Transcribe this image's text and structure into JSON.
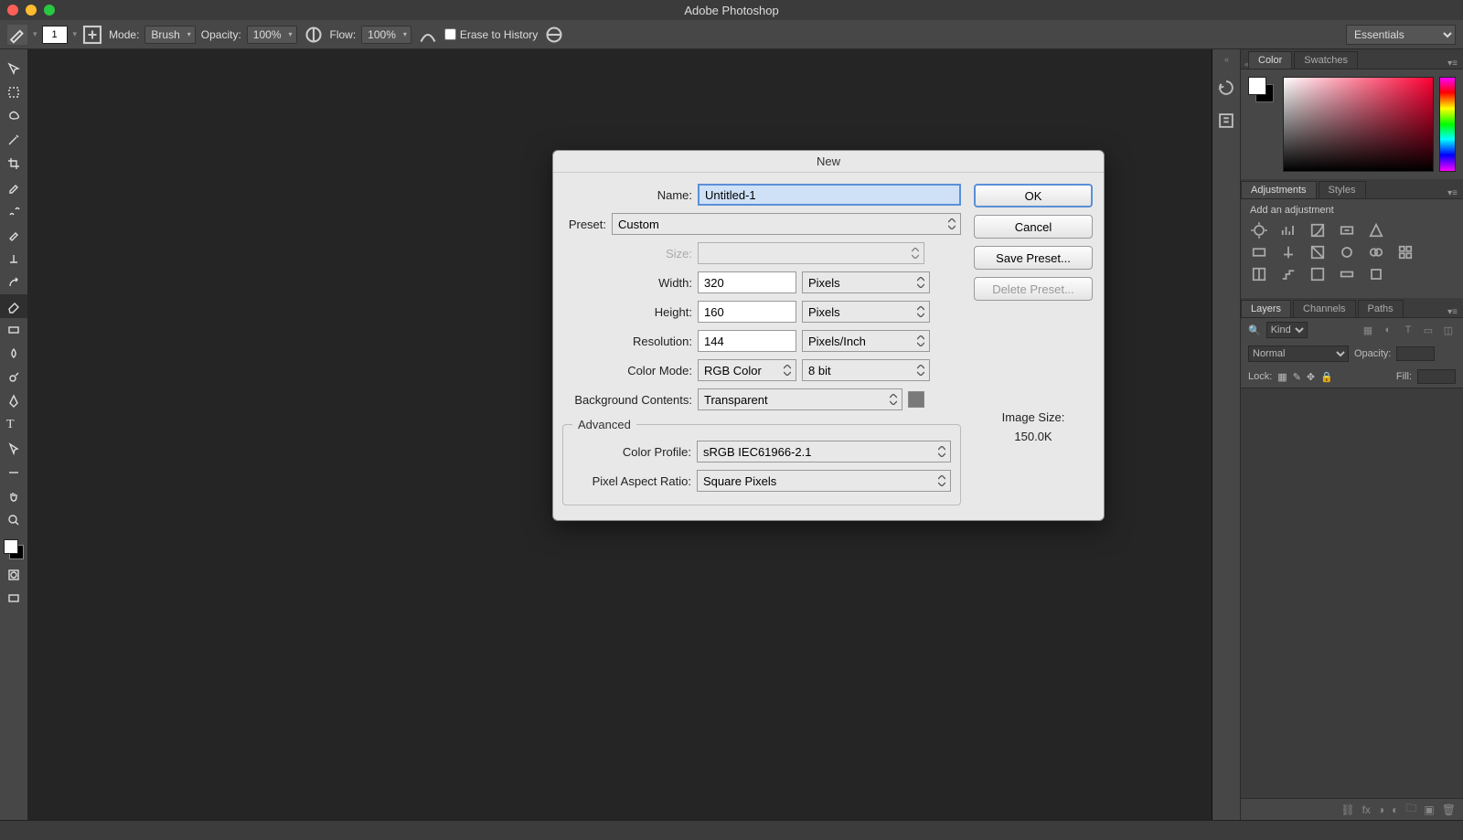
{
  "app_title": "Adobe Photoshop",
  "options_bar": {
    "brush_size": "1",
    "mode_label": "Mode:",
    "mode_value": "Brush",
    "opacity_label": "Opacity:",
    "opacity_value": "100%",
    "flow_label": "Flow:",
    "flow_value": "100%",
    "erase_to_history_label": "Erase to History",
    "workspace_value": "Essentials"
  },
  "dialog": {
    "title": "New",
    "labels": {
      "name": "Name:",
      "preset": "Preset:",
      "size": "Size:",
      "width": "Width:",
      "height": "Height:",
      "resolution": "Resolution:",
      "color_mode": "Color Mode:",
      "background_contents": "Background Contents:",
      "advanced": "Advanced",
      "color_profile": "Color Profile:",
      "pixel_aspect_ratio": "Pixel Aspect Ratio:",
      "image_size_header": "Image Size:"
    },
    "values": {
      "name": "Untitled-1",
      "preset": "Custom",
      "size": "",
      "width": "320",
      "width_unit": "Pixels",
      "height": "160",
      "height_unit": "Pixels",
      "resolution": "144",
      "resolution_unit": "Pixels/Inch",
      "color_mode": "RGB Color",
      "bit_depth": "8 bit",
      "background_contents": "Transparent",
      "color_profile": "sRGB IEC61966-2.1",
      "pixel_aspect_ratio": "Square Pixels",
      "image_size": "150.0K"
    },
    "buttons": {
      "ok": "OK",
      "cancel": "Cancel",
      "save_preset": "Save Preset...",
      "delete_preset": "Delete Preset..."
    }
  },
  "panels": {
    "color_tab": "Color",
    "swatches_tab": "Swatches",
    "adjustments_tab": "Adjustments",
    "styles_tab": "Styles",
    "add_adjustment_label": "Add an adjustment",
    "layers_tab": "Layers",
    "channels_tab": "Channels",
    "paths_tab": "Paths",
    "layers_filter_label": "Kind",
    "layers_blendmode": "Normal",
    "layers_opacity_label": "Opacity:",
    "layers_lock_label": "Lock:",
    "layers_fill_label": "Fill:"
  }
}
